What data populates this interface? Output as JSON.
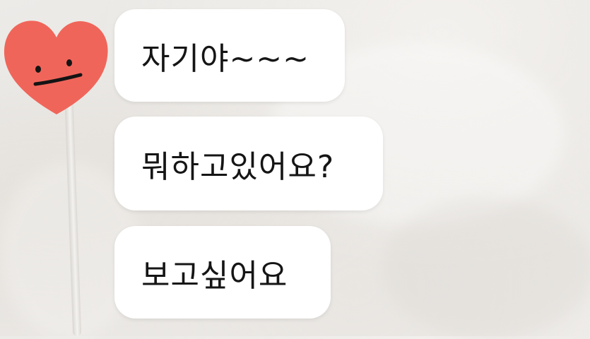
{
  "chat": {
    "messages": [
      {
        "text": "자기야~~~"
      },
      {
        "text": "뭐하고있어요?"
      },
      {
        "text": "보고싶어요"
      }
    ]
  },
  "avatar": {
    "icon": "smiling-heart-icon",
    "color": "#f0655a"
  },
  "colors": {
    "bubble": "#ffffff",
    "text": "#151515",
    "background": "#ebe9e6"
  }
}
